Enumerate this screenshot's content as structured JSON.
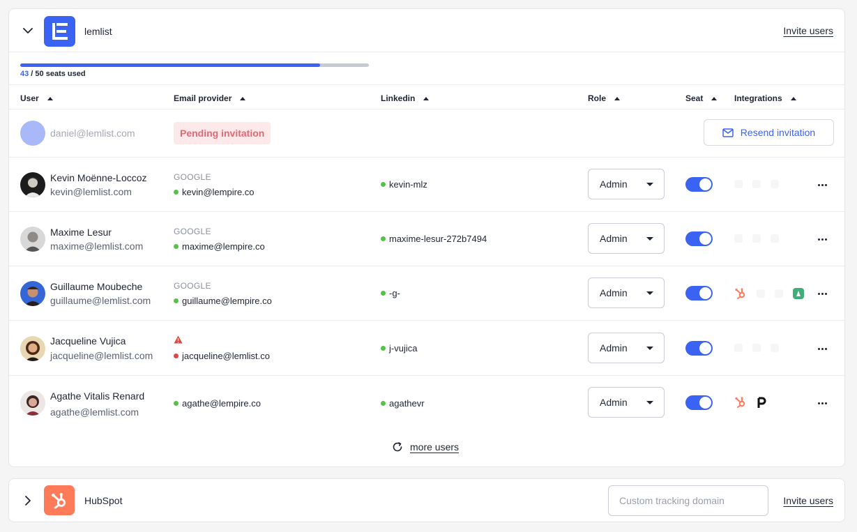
{
  "lemlist": {
    "name": "lemlist",
    "invite_label": "Invite users",
    "seats_used": 43,
    "seats_total": 50,
    "seats_used_text": "43",
    "seats_suffix_text": " / 50 seats used",
    "columns": [
      "User",
      "Email provider",
      "Linkedin",
      "Role",
      "Seat",
      "Integrations"
    ],
    "pending": {
      "email": "daniel@lemlist.com",
      "status": "Pending invitation",
      "resend_label": "Resend invitation"
    },
    "users": [
      {
        "name": "Kevin Moënne-Loccoz",
        "email": "kevin@lemlist.com",
        "provider": "GOOGLE",
        "provider_email": "kevin@lempire.co",
        "linkedin": "kevin-mlz",
        "role": "Admin"
      },
      {
        "name": "Maxime Lesur",
        "email": "maxime@lemlist.com",
        "provider": "GOOGLE",
        "provider_email": "maxime@lempire.co",
        "linkedin": "maxime-lesur-272b7494",
        "role": "Admin"
      },
      {
        "name": "Guillaume Moubeche",
        "email": "guillaume@lemlist.com",
        "provider": "GOOGLE",
        "provider_email": "guillaume@lempire.co",
        "linkedin": "-g-",
        "role": "Admin"
      },
      {
        "name": "Jacqueline Vujica",
        "email": "jacqueline@lemlist.com",
        "provider": "",
        "provider_email": "jacqueline@lemlist.co",
        "linkedin": "j-vujica",
        "role": "Admin"
      },
      {
        "name": "Agathe Vitalis Renard",
        "email": "agathe@lemlist.com",
        "provider": "",
        "provider_email": "agathe@lempire.co",
        "linkedin": "agathevr",
        "role": "Admin"
      }
    ],
    "more_users_label": "more users"
  },
  "hubspot": {
    "name": "HubSpot",
    "domain_placeholder": "Custom tracking domain",
    "invite_label": "Invite users"
  },
  "colors": {
    "accent": "#3b63f3",
    "hubspot": "#ff7a59",
    "pending_bg": "#fde8ea",
    "pending_text": "#e36874",
    "status_ok": "#54c247",
    "status_error": "#e04444"
  }
}
